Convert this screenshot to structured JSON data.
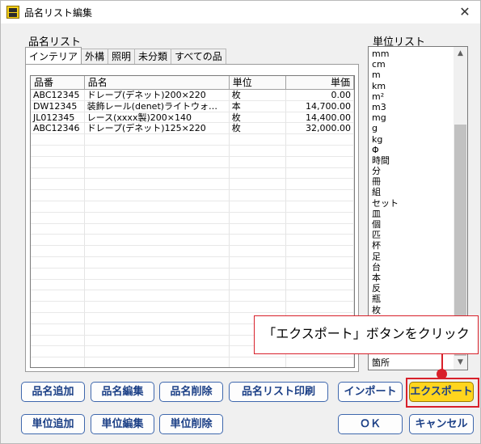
{
  "window": {
    "title": "品名リスト編集",
    "close_glyph": "✕"
  },
  "item_list": {
    "label": "品名リスト",
    "tabs": [
      "インテリア",
      "外構",
      "照明",
      "未分類",
      "すべての品"
    ],
    "active_tab": 0,
    "columns": [
      "品番",
      "品名",
      "単位",
      "単価"
    ],
    "rows": [
      [
        "ABC12345",
        "ドレープ(デネット)200×220",
        "枚",
        "0.00"
      ],
      [
        "DW12345",
        "装飾レール(denet)ライトウォ…",
        "本",
        "14,700.00"
      ],
      [
        "JL012345",
        "レース(xxxx製)200×140",
        "枚",
        "14,400.00"
      ],
      [
        "ABC12346",
        "ドレープ(デネット)125×220",
        "枚",
        "32,000.00"
      ]
    ]
  },
  "unit_list": {
    "label": "単位リスト",
    "items": [
      "mm",
      "cm",
      "m",
      "km",
      "m²",
      "m3",
      "mg",
      "g",
      "kg",
      "Φ",
      "時間",
      "分",
      "冊",
      "組",
      "セット",
      "皿",
      "個",
      "匹",
      "杯",
      "足",
      "台",
      "本",
      "反",
      "瓶",
      "枚",
      "",
      "",
      "",
      "",
      "箇所"
    ],
    "scroll_up_glyph": "▲",
    "scroll_down_glyph": "▼"
  },
  "buttons": {
    "add_item": "品名追加",
    "edit_item": "品名編集",
    "delete_item": "品名削除",
    "print_list": "品名リスト印刷",
    "import": "インポート",
    "export": "エクスポート",
    "add_unit": "単位追加",
    "edit_unit": "単位編集",
    "delete_unit": "単位削除",
    "ok": "ＯＫ",
    "cancel": "キャンセル"
  },
  "callout": {
    "text": "「エクスポート」ボタンをクリック"
  },
  "colors": {
    "highlight": "#ffd51e",
    "annotation": "#d8202a",
    "button_text": "#1b3f86"
  }
}
